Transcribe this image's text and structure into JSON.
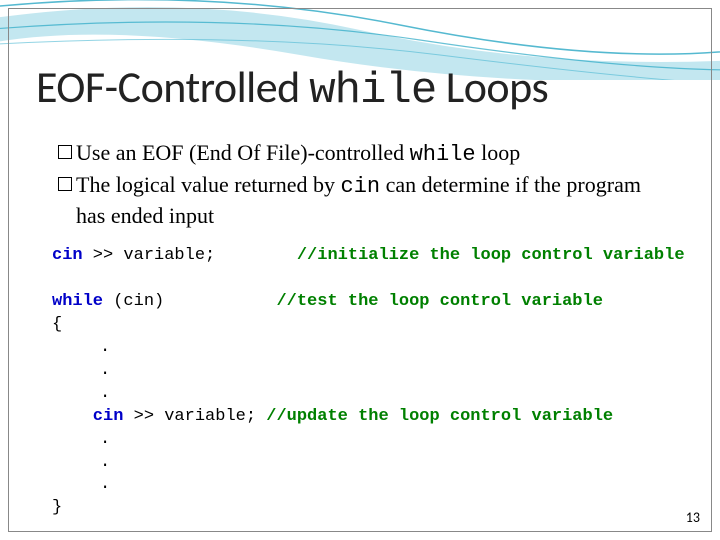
{
  "title": {
    "pre": "EOF-Controlled ",
    "mono": "while",
    "post": " Loops"
  },
  "bullets": [
    {
      "pre": "Use an EOF (End Of File)-controlled ",
      "mono": "while",
      "post": " loop"
    },
    {
      "pre": "The logical value returned by ",
      "mono": "cin",
      "post": " can determine if the program has ended input"
    }
  ],
  "code": {
    "l1_kw": "cin",
    "l1_rest": " >> variable;",
    "l1_cm": "//initialize the loop control variable",
    "blank1": "",
    "l2_kw": "while",
    "l2_rest": " (cin)",
    "l2_cm": "//test the loop control variable",
    "l3": "{",
    "d1": ".",
    "d2": ".",
    "d3": ".",
    "l4_kw": "    cin",
    "l4_rest": " >> variable; ",
    "l4_cm": "//update the loop control variable",
    "d4": ".",
    "d5": ".",
    "d6": ".",
    "l5": "}"
  },
  "page_number": "13"
}
